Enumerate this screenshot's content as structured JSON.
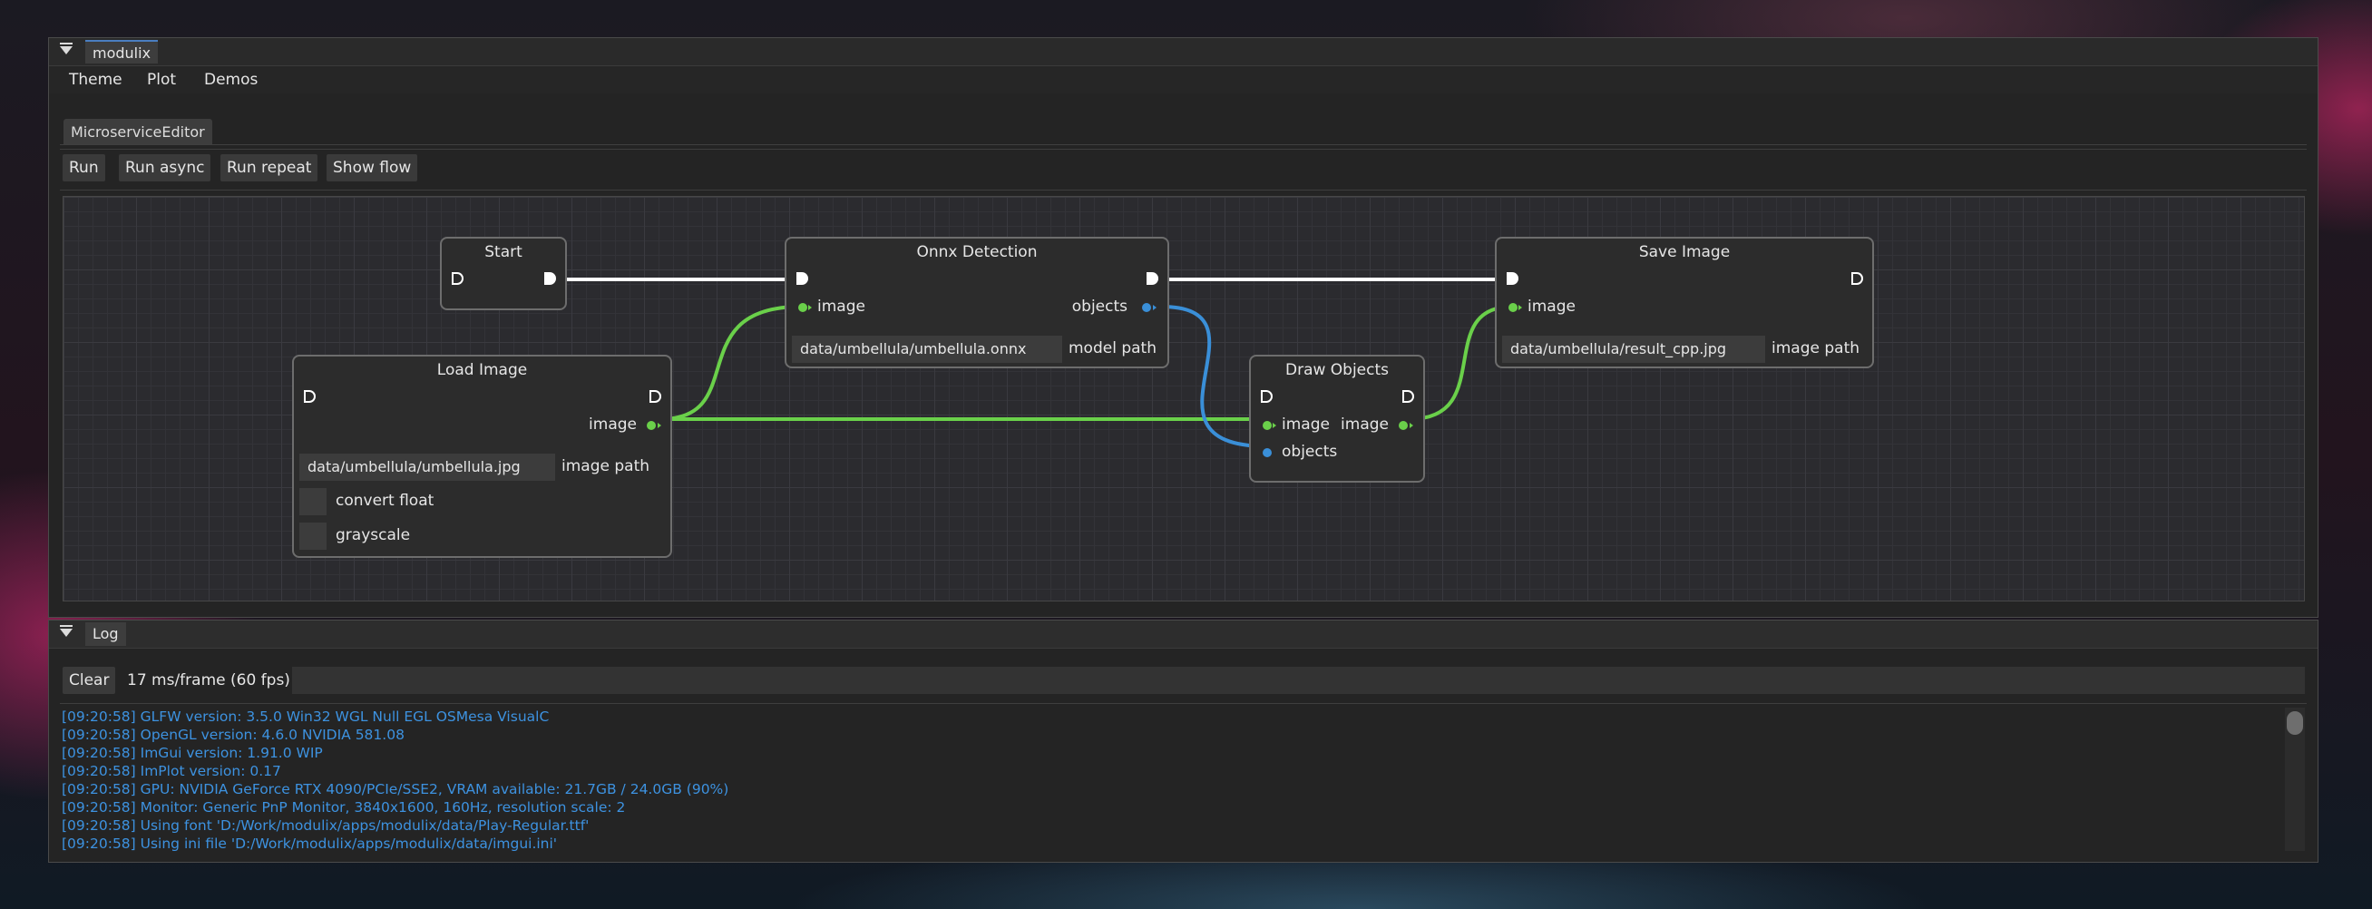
{
  "app": {
    "title": "modulix"
  },
  "menu": [
    "Theme",
    "Plot",
    "Demos"
  ],
  "editor": {
    "tab": "MicroserviceEditor",
    "toolbar": {
      "run": "Run",
      "run_async": "Run async",
      "run_repeat": "Run repeat",
      "show_flow": "Show flow"
    }
  },
  "nodes": {
    "start": {
      "title": "Start"
    },
    "load_image": {
      "title": "Load Image",
      "out_image": "image",
      "path_value": "data/umbellula/umbellula.jpg",
      "path_label": "image path",
      "convert_float": "convert float",
      "grayscale": "grayscale"
    },
    "onnx": {
      "title": "Onnx Detection",
      "in_image": "image",
      "out_objects": "objects",
      "model_value": "data/umbellula/umbellula.onnx",
      "model_label": "model path"
    },
    "draw": {
      "title": "Draw Objects",
      "in_image": "image",
      "out_image": "image",
      "in_objects": "objects"
    },
    "save": {
      "title": "Save Image",
      "in_image": "image",
      "path_value": "data/umbellula/result_cpp.jpg",
      "path_label": "image path"
    }
  },
  "link_colors": {
    "flow": "#ffffff",
    "image": "#6ad04a",
    "objects": "#3a8fd8"
  },
  "log": {
    "title": "Log",
    "clear": "Clear",
    "fps": "17 ms/frame (60 fps)",
    "lines": [
      "[09:20:58] GLFW version: 3.5.0 Win32 WGL Null EGL OSMesa VisualC",
      "[09:20:58] OpenGL version: 4.6.0 NVIDIA 581.08",
      "[09:20:58] ImGui version: 1.91.0 WIP",
      "[09:20:58] ImPlot version: 0.17",
      "[09:20:58] GPU: NVIDIA GeForce RTX 4090/PCIe/SSE2, VRAM available: 21.7GB / 24.0GB (90%)",
      "[09:20:58] Monitor: Generic PnP Monitor, 3840x1600, 160Hz, resolution scale: 2",
      "[09:20:58] Using font 'D:/Work/modulix/apps/modulix/data/Play-Regular.ttf'",
      "[09:20:58] Using ini file 'D:/Work/modulix/apps/modulix/data/imgui.ini'"
    ]
  }
}
